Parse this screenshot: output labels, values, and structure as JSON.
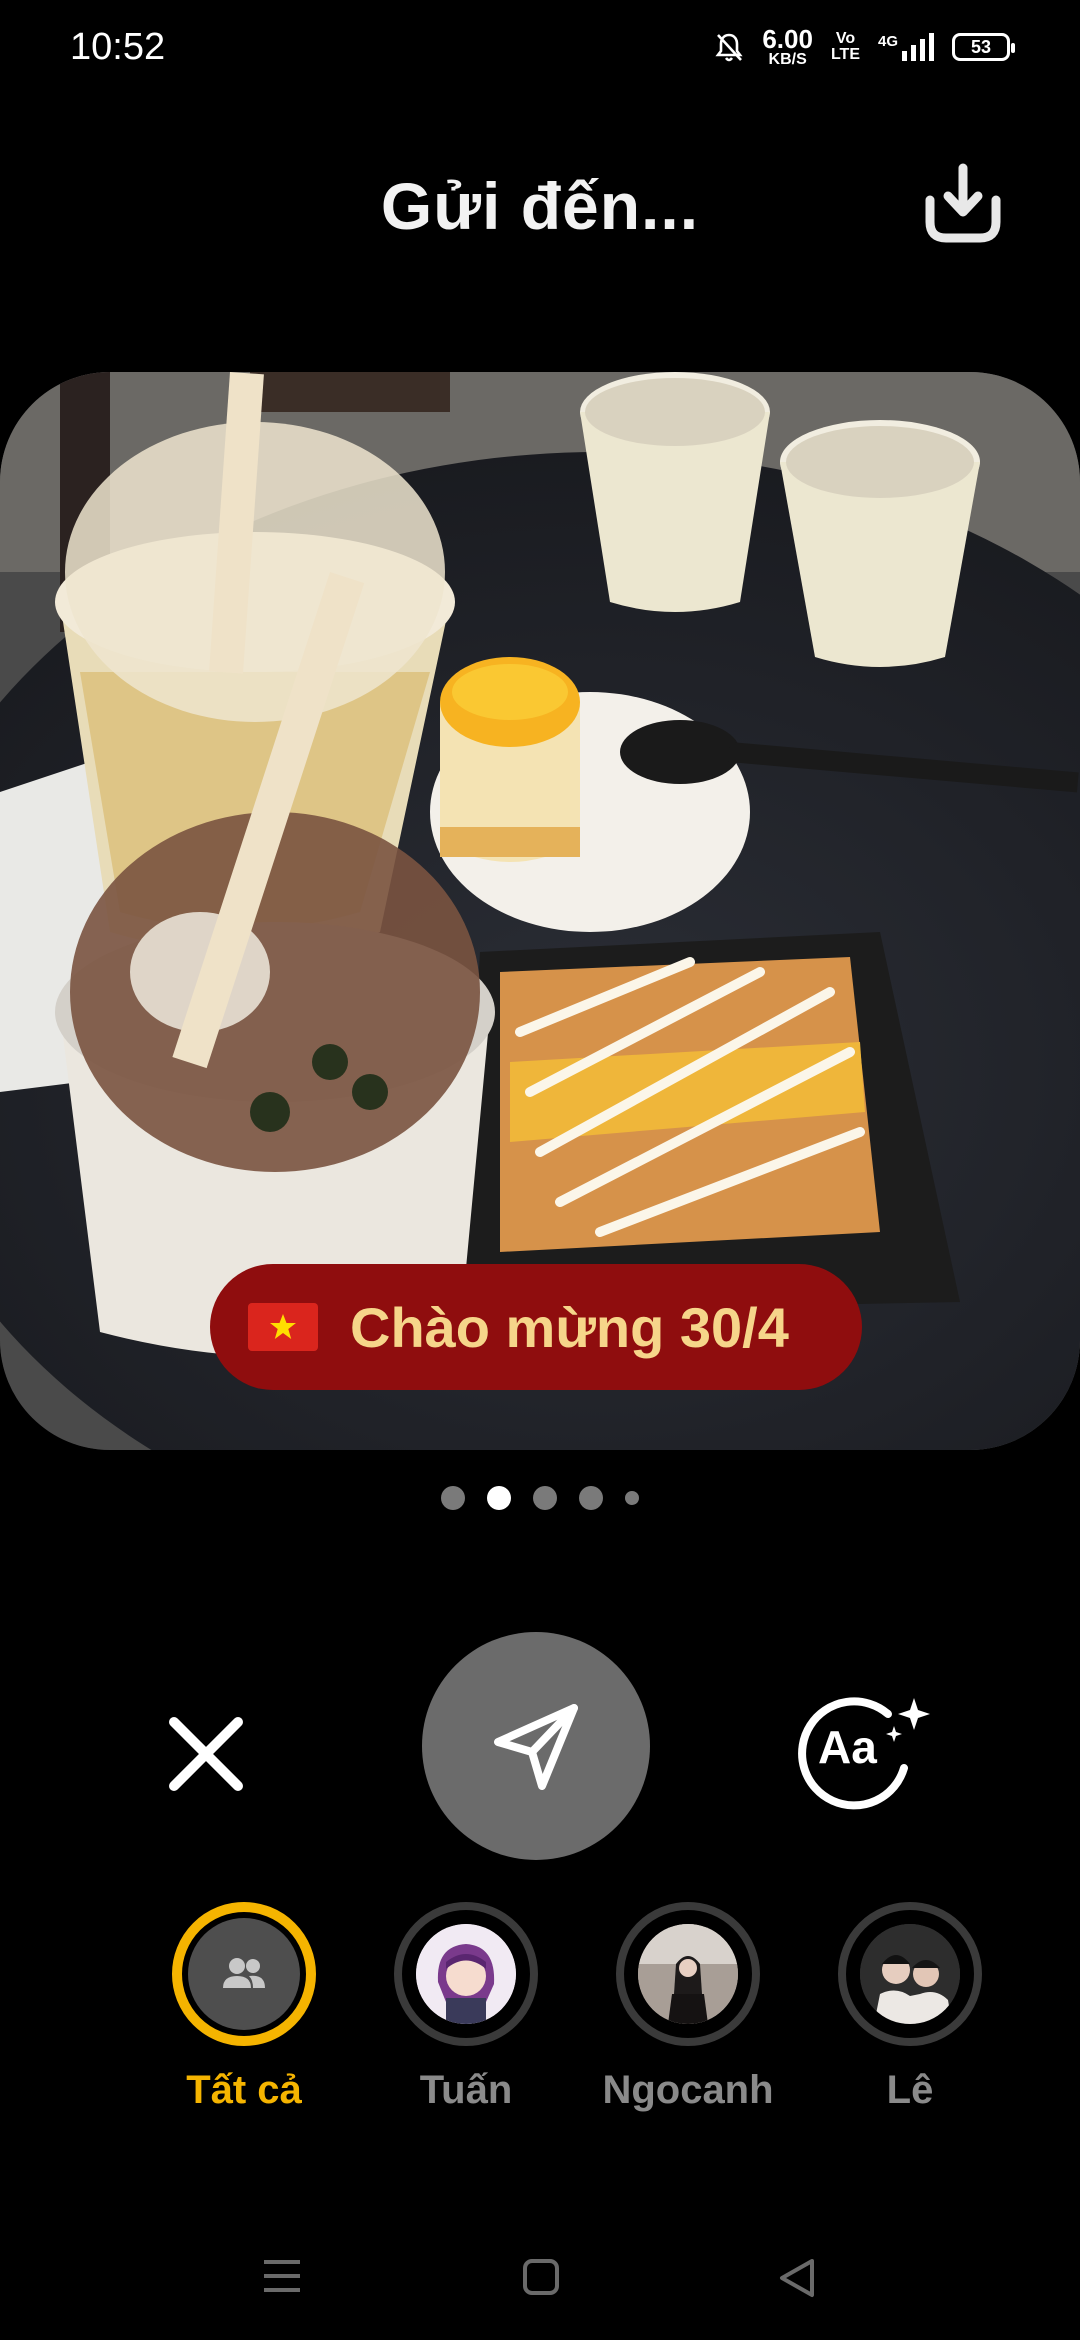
{
  "status_bar": {
    "time": "10:52",
    "net_speed_value": "6.00",
    "net_speed_unit": "KB/S",
    "volte_top": "Vo",
    "volte_bottom": "LTE",
    "network": "4G",
    "battery": "53"
  },
  "header": {
    "title": "Gửi đến..."
  },
  "photo": {
    "caption": "Chào mừng 30/4"
  },
  "pager": {
    "count": 5,
    "active_index": 1
  },
  "actions": {
    "close_icon": "close-icon",
    "send_icon": "send-icon",
    "text_icon": "text-style-icon",
    "text_icon_label": "Aa"
  },
  "recipients": [
    {
      "label": "Tất cả",
      "selected": true
    },
    {
      "label": "Tuấn",
      "selected": false
    },
    {
      "label": "Ngocanh",
      "selected": false
    },
    {
      "label": "Lê",
      "selected": false
    }
  ],
  "colors": {
    "accent": "#f5b400",
    "caption_bg": "#8f0d0e",
    "caption_text": "#f6d58a",
    "send_bg": "#6b6b6b"
  }
}
